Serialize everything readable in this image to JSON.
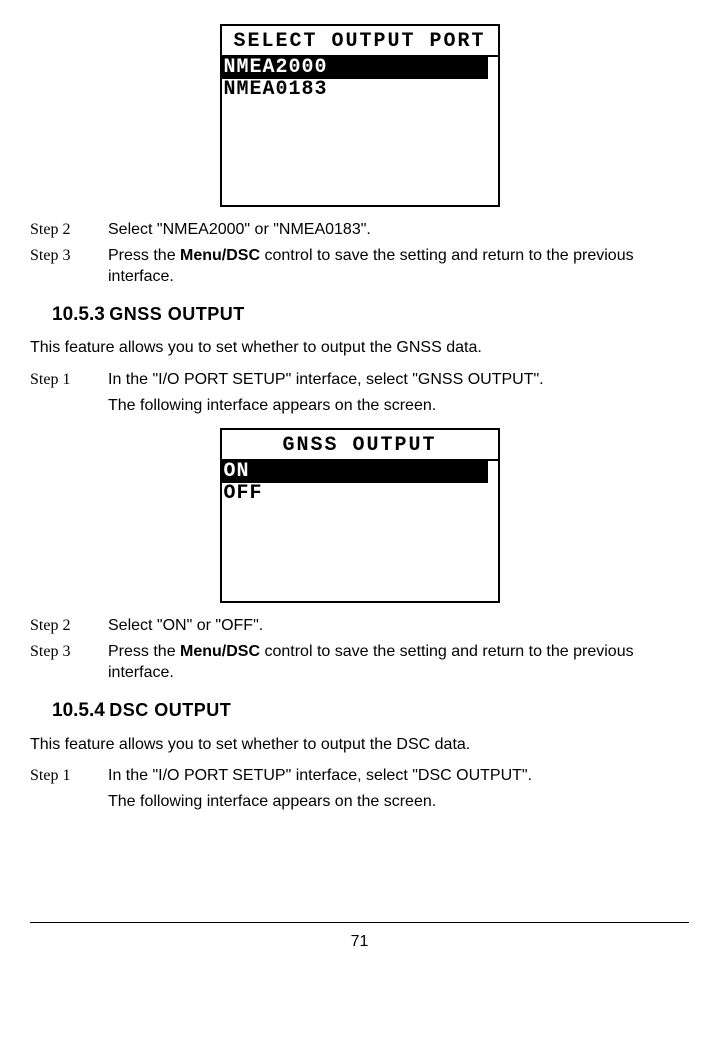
{
  "screen1": {
    "title": "SELECT OUTPUT PORT",
    "opt1": "NMEA2000",
    "opt2": "NMEA0183"
  },
  "s1_step2_label": "Step 2",
  "s1_step2_text": "Select \"NMEA2000\" or \"NMEA0183\".",
  "s1_step3_label": "Step 3",
  "s1_step3_pre": "Press the ",
  "s1_step3_bold": "Menu/DSC",
  "s1_step3_post": " control to save the setting and return to the previous interface.",
  "sec53_num": "10.5.3",
  "sec53_title": "GNSS OUTPUT",
  "sec53_intro": "This feature allows you to set whether to output the GNSS data.",
  "sec53_step1_label": "Step 1",
  "sec53_step1_a": "In the \"I/O PORT SETUP\" interface, select \"GNSS OUTPUT\".",
  "sec53_step1_b": "The following interface appears on the screen.",
  "screen2": {
    "title": "GNSS OUTPUT",
    "opt1": "ON",
    "opt2": "OFF"
  },
  "s2_step2_label": "Step 2",
  "s2_step2_text": "Select \"ON\" or \"OFF\".",
  "s2_step3_label": "Step 3",
  "s2_step3_pre": "Press the ",
  "s2_step3_bold": "Menu/DSC",
  "s2_step3_post": " control to save the setting and return to the previous interface.",
  "sec54_num": "10.5.4",
  "sec54_title": "DSC OUTPUT",
  "sec54_intro": "This feature allows you to set whether to output the DSC data.",
  "sec54_step1_label": "Step 1",
  "sec54_step1_a": "In the \"I/O PORT SETUP\" interface, select \"DSC OUTPUT\".",
  "sec54_step1_b": "The following interface appears on the screen.",
  "page_number": "71"
}
